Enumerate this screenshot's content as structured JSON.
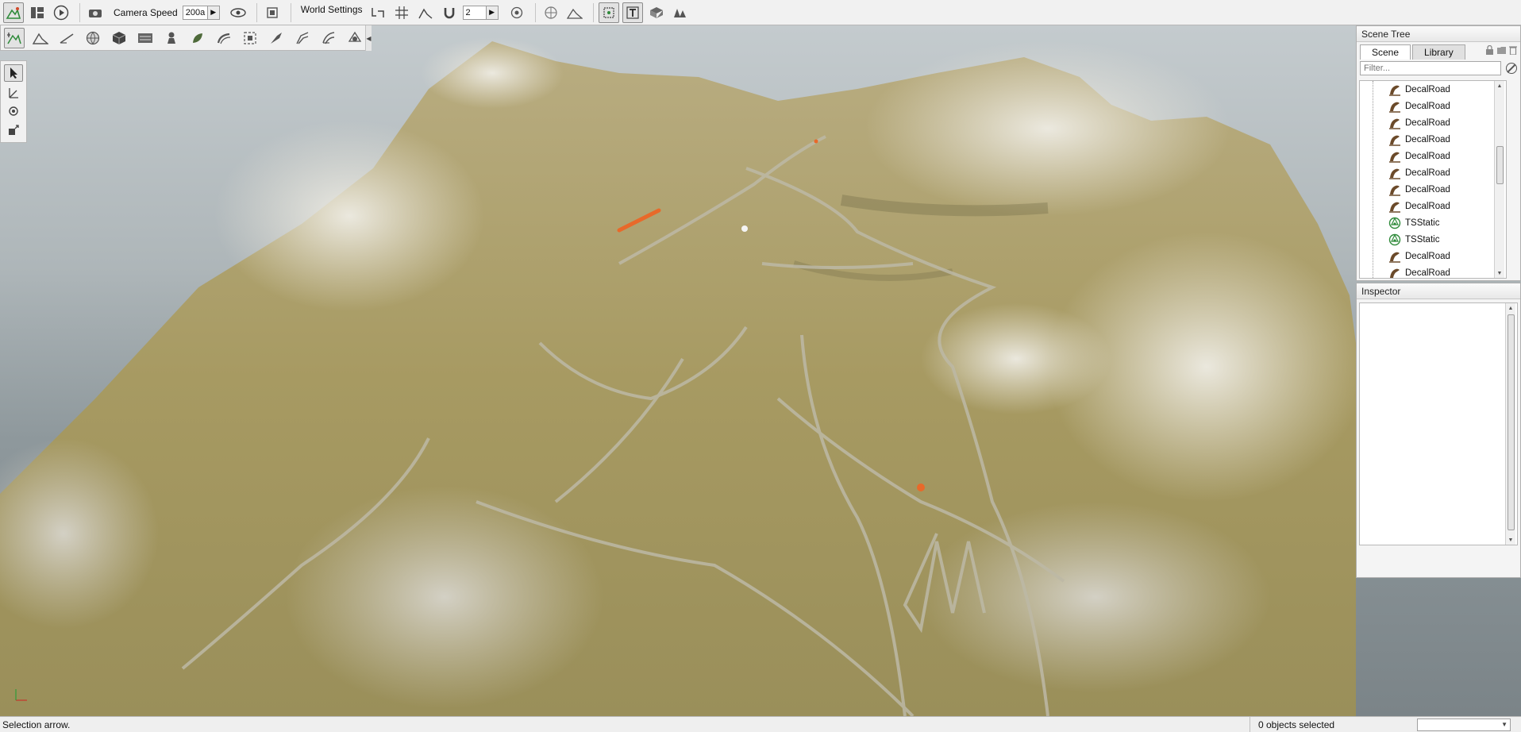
{
  "toolbar": {
    "camera_speed_label": "Camera Speed",
    "camera_speed_value": "200a",
    "world_settings_label": "World Settings",
    "grid_value": "2"
  },
  "scene_tree": {
    "title": "Scene Tree",
    "tabs": [
      {
        "label": "Scene",
        "active": true
      },
      {
        "label": "Library",
        "active": false
      }
    ],
    "filter_placeholder": "Filter...",
    "items": [
      {
        "label": "DecalRoad",
        "icon": "decal-road-icon"
      },
      {
        "label": "DecalRoad",
        "icon": "decal-road-icon"
      },
      {
        "label": "DecalRoad",
        "icon": "decal-road-icon"
      },
      {
        "label": "DecalRoad",
        "icon": "decal-road-icon"
      },
      {
        "label": "DecalRoad",
        "icon": "decal-road-icon"
      },
      {
        "label": "DecalRoad",
        "icon": "decal-road-icon"
      },
      {
        "label": "DecalRoad",
        "icon": "decal-road-icon"
      },
      {
        "label": "DecalRoad",
        "icon": "decal-road-icon"
      },
      {
        "label": "TSStatic",
        "icon": "ts-static-icon"
      },
      {
        "label": "TSStatic",
        "icon": "ts-static-icon"
      },
      {
        "label": "DecalRoad",
        "icon": "decal-road-icon"
      },
      {
        "label": "DecalRoad",
        "icon": "decal-road-icon"
      }
    ]
  },
  "inspector": {
    "title": "Inspector"
  },
  "status": {
    "message": "Selection arrow.",
    "selection_count": "0 objects selected"
  },
  "colors": {
    "road_icon": "#6b4a2a",
    "static_icon": "#2f8a3a",
    "marker": "#e8692a",
    "terrain": "#a89a66"
  }
}
